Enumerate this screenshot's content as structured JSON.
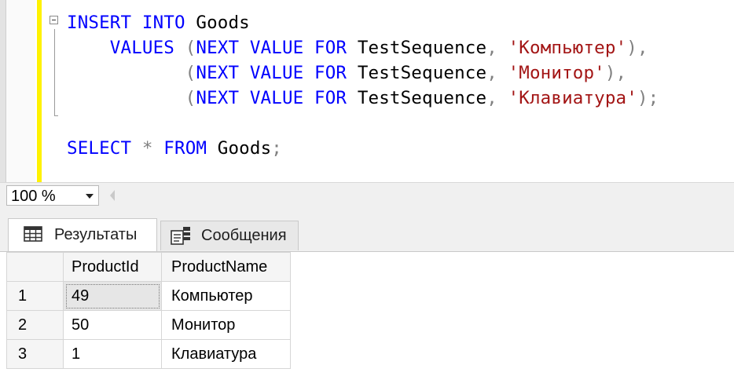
{
  "editor": {
    "lines": [
      {
        "parts": [
          [
            "kw",
            "INSERT"
          ],
          [
            "t",
            " "
          ],
          [
            "kw",
            "INTO"
          ],
          [
            "t",
            " Goods"
          ]
        ]
      },
      {
        "parts": [
          [
            "t",
            "    "
          ],
          [
            "kw",
            "VALUES"
          ],
          [
            "t",
            " "
          ],
          [
            "op",
            "("
          ],
          [
            "kw",
            "NEXT VALUE FOR"
          ],
          [
            "t",
            " TestSequence"
          ],
          [
            "op",
            ","
          ],
          [
            "t",
            " "
          ],
          [
            "str",
            "'Компьютер'"
          ],
          [
            "op",
            "),"
          ]
        ]
      },
      {
        "parts": [
          [
            "t",
            "           "
          ],
          [
            "op",
            "("
          ],
          [
            "kw",
            "NEXT VALUE FOR"
          ],
          [
            "t",
            " TestSequence"
          ],
          [
            "op",
            ","
          ],
          [
            "t",
            " "
          ],
          [
            "str",
            "'Монитор'"
          ],
          [
            "op",
            "),"
          ]
        ]
      },
      {
        "parts": [
          [
            "t",
            "           "
          ],
          [
            "op",
            "("
          ],
          [
            "kw",
            "NEXT VALUE FOR"
          ],
          [
            "t",
            " TestSequence"
          ],
          [
            "op",
            ","
          ],
          [
            "t",
            " "
          ],
          [
            "str",
            "'Клавиатура'"
          ],
          [
            "op",
            ");"
          ]
        ]
      },
      {
        "parts": [
          [
            "kw",
            "SELECT"
          ],
          [
            "t",
            " "
          ],
          [
            "op",
            "*"
          ],
          [
            "t",
            " "
          ],
          [
            "kw",
            "FROM"
          ],
          [
            "t",
            " Goods"
          ],
          [
            "op",
            ";"
          ]
        ]
      }
    ],
    "colors": {
      "keyword": "#0000ff",
      "string": "#a31515",
      "operator": "#808080",
      "change_bar": "#fff200"
    }
  },
  "zoom": {
    "value": "100 %"
  },
  "tabs": {
    "results_label": "Результаты",
    "messages_label": "Сообщения",
    "results_icon": "grid-icon",
    "messages_icon": "messages-icon"
  },
  "results": {
    "columns": [
      "ProductId",
      "ProductName"
    ],
    "rows": [
      {
        "num": "1",
        "id": "49",
        "name": "Компьютер"
      },
      {
        "num": "2",
        "id": "50",
        "name": "Монитор"
      },
      {
        "num": "3",
        "id": "1",
        "name": "Клавиатура"
      }
    ]
  }
}
